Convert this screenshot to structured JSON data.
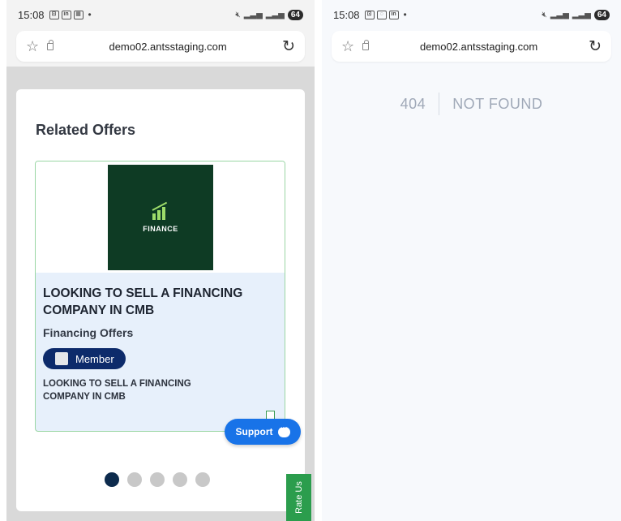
{
  "left_phone": {
    "status": {
      "time": "15:08",
      "battery": "64",
      "icons": [
        "scan-icon",
        "linkedin-icon",
        "grid-icon"
      ]
    },
    "browser": {
      "url": "demo02.antsstaging.com"
    },
    "related_offers": {
      "title": "Related Offers",
      "offer": {
        "image_label": "FINANCE",
        "title": "LOOKING TO SELL A FINANCING COMPANY IN CMB",
        "category": "Financing Offers",
        "badge": "Member",
        "description": "LOOKING TO SELL A FINANCING COMPANY IN CMB"
      },
      "carousel": {
        "count": 5,
        "active_index": 0
      }
    },
    "support_button": "Support",
    "rate_us": "Rate Us"
  },
  "right_phone": {
    "status": {
      "time": "15:08",
      "battery": "64",
      "icons": [
        "scan-icon",
        "whatsapp-icon",
        "linkedin-icon"
      ]
    },
    "browser": {
      "url": "demo02.antsstaging.com"
    },
    "error": {
      "code": "404",
      "message": "NOT FOUND"
    }
  },
  "colors": {
    "brand_navy": "#0d2b6b",
    "support_blue": "#1873e8",
    "rate_us_green": "#2b9d4d",
    "finance_bg": "#0e3b24"
  }
}
